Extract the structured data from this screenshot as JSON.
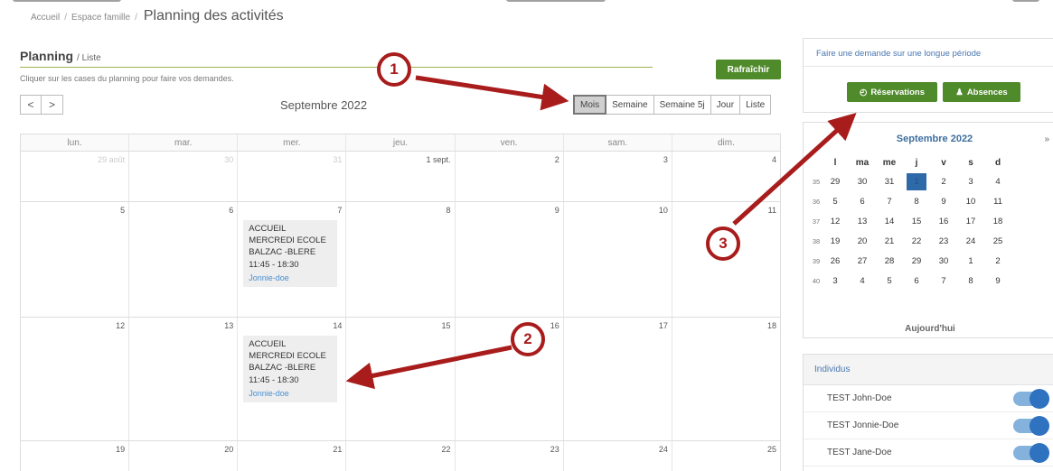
{
  "breadcrumb": {
    "home": "Accueil",
    "section": "Espace famille",
    "current": "Planning des activités",
    "separator": "/"
  },
  "planning": {
    "title": "Planning",
    "title_suffix": "/ Liste",
    "hint": "Cliquer sur les cases du planning pour faire vos demandes.",
    "refresh_label": "Rafraîchir",
    "prev_label": "<",
    "next_label": ">",
    "month_label": "Septembre 2022",
    "views": [
      {
        "label": "Mois",
        "active": true
      },
      {
        "label": "Semaine",
        "active": false
      },
      {
        "label": "Semaine 5j",
        "active": false
      },
      {
        "label": "Jour",
        "active": false
      },
      {
        "label": "Liste",
        "active": false
      }
    ]
  },
  "calendar": {
    "weekdays": [
      "lun.",
      "mar.",
      "mer.",
      "jeu.",
      "ven.",
      "sam.",
      "dim."
    ],
    "rows": [
      [
        {
          "day": "29 août",
          "other": true
        },
        {
          "day": "30",
          "other": true
        },
        {
          "day": "31",
          "other": true
        },
        {
          "day": "1 sept."
        },
        {
          "day": "2"
        },
        {
          "day": "3"
        },
        {
          "day": "4"
        }
      ],
      [
        {
          "day": "5"
        },
        {
          "day": "6"
        },
        {
          "day": "7"
        },
        {
          "day": "8"
        },
        {
          "day": "9"
        },
        {
          "day": "10"
        },
        {
          "day": "11"
        }
      ],
      [
        {
          "day": "12"
        },
        {
          "day": "13"
        },
        {
          "day": "14"
        },
        {
          "day": "15"
        },
        {
          "day": "16"
        },
        {
          "day": "17"
        },
        {
          "day": "18"
        }
      ],
      [
        {
          "day": "19"
        },
        {
          "day": "20"
        },
        {
          "day": "21"
        },
        {
          "day": "22"
        },
        {
          "day": "23"
        },
        {
          "day": "24"
        },
        {
          "day": "25"
        }
      ]
    ],
    "events": [
      {
        "name_lines": [
          "ACCUEIL",
          "MERCREDI ECOLE",
          "BALZAC -BLERE"
        ],
        "time": "11:45 - 18:30",
        "person": "Jonnie-doe"
      },
      {
        "name_lines": [
          "ACCUEIL",
          "MERCREDI ECOLE",
          "BALZAC -BLERE"
        ],
        "time": "11:45 - 18:30",
        "person": "Jonnie-doe"
      }
    ]
  },
  "sidebar": {
    "long_period_title": "Faire une demande sur une longue période",
    "reservations_label": "Réservations",
    "absences_label": "Absences",
    "mini_calendar": {
      "title": "Septembre 2022",
      "next_label": "»",
      "weekdays": [
        "l",
        "ma",
        "me",
        "j",
        "v",
        "s",
        "d"
      ],
      "weeks": [
        {
          "wk": "35",
          "days": [
            "29",
            "30",
            "31",
            "1",
            "2",
            "3",
            "4"
          ]
        },
        {
          "wk": "36",
          "days": [
            "5",
            "6",
            "7",
            "8",
            "9",
            "10",
            "11"
          ]
        },
        {
          "wk": "37",
          "days": [
            "12",
            "13",
            "14",
            "15",
            "16",
            "17",
            "18"
          ]
        },
        {
          "wk": "38",
          "days": [
            "19",
            "20",
            "21",
            "22",
            "23",
            "24",
            "25"
          ]
        },
        {
          "wk": "39",
          "days": [
            "26",
            "27",
            "28",
            "29",
            "30",
            "1",
            "2"
          ]
        },
        {
          "wk": "40",
          "days": [
            "3",
            "4",
            "5",
            "6",
            "7",
            "8",
            "9"
          ]
        }
      ],
      "today_label": "Aujourd'hui"
    },
    "individus_title": "Individus",
    "individus": [
      {
        "name": "TEST John-Doe",
        "enabled": true
      },
      {
        "name": "TEST Jonnie-Doe",
        "enabled": true
      },
      {
        "name": "TEST Jane-Doe",
        "enabled": true
      }
    ]
  },
  "annotations": [
    "1",
    "2",
    "3"
  ],
  "colors": {
    "accent_green": "#4f8a2b",
    "annotation_red": "#a81c1c",
    "link_blue": "#4a78b0",
    "today_blue": "#2f6aa8"
  }
}
